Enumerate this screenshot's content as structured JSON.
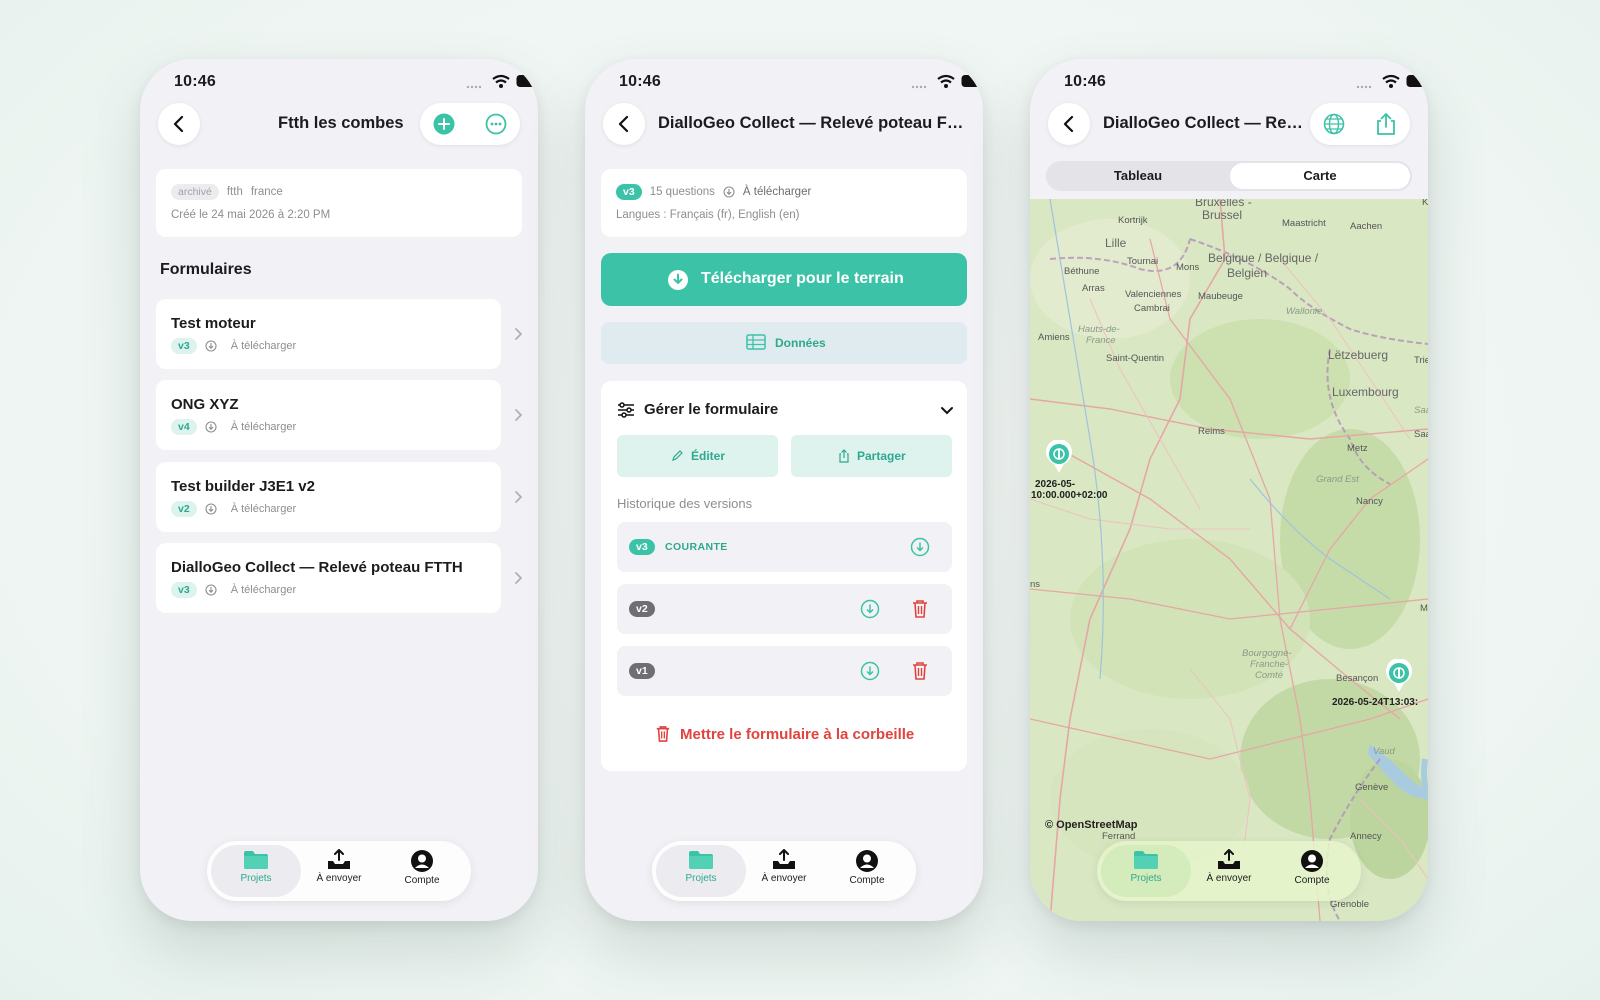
{
  "status_time": "10:46",
  "tabbar": {
    "projects": "Projets",
    "to_send": "À envoyer",
    "account": "Compte"
  },
  "screen1": {
    "title": "Ftth les combes",
    "project_card": {
      "status_chip": "archivé",
      "tags": [
        "ftth",
        "france"
      ],
      "created": "Créé le 24 mai 2026 à 2:20 PM"
    },
    "section_title": "Formulaires",
    "forms": [
      {
        "name": "Test moteur",
        "version": "v3",
        "status": "À télécharger"
      },
      {
        "name": "ONG XYZ",
        "version": "v4",
        "status": "À télécharger"
      },
      {
        "name": "Test builder J3E1 v2",
        "version": "v2",
        "status": "À télécharger"
      },
      {
        "name": "DialloGeo Collect — Relevé poteau FTTH",
        "version": "v3",
        "status": "À télécharger"
      }
    ]
  },
  "screen2": {
    "title": "DialloGeo Collect — Relevé poteau FT...",
    "info": {
      "version": "v3",
      "questions": "15 questions",
      "status": "À télécharger",
      "languages": "Langues : Français (fr), English (en)"
    },
    "download_button": "Télécharger pour le terrain",
    "data_button": "Données",
    "manage": {
      "title": "Gérer le formulaire",
      "edit": "Éditer",
      "share": "Partager"
    },
    "history_label": "Historique des versions",
    "versions": [
      {
        "version": "v3",
        "tag": "COURANTE"
      },
      {
        "version": "v2",
        "tag": ""
      },
      {
        "version": "v1",
        "tag": ""
      }
    ],
    "trash_button": "Mettre le formulaire à la corbeille"
  },
  "screen3": {
    "title": "DialloGeo Collect — Rel...",
    "segments": {
      "table": "Tableau",
      "map": "Carte"
    },
    "selected_segment": "Carte",
    "map_labels": {
      "bruxelles": "Bruxelles -",
      "brussel": "Brussel",
      "kortrijk": "Kortrijk",
      "maastricht": "Maastricht",
      "aachen": "Aachen",
      "lille": "Lille",
      "tournai": "Tournai",
      "belgique": "Belgique / Belgique /",
      "belgien": "Belgien",
      "bethune": "Béthune",
      "mons": "Mons",
      "arras": "Arras",
      "valenciennes": "Valenciennes",
      "maubeuge": "Maubeuge",
      "cambrai": "Cambrai",
      "wallonie": "Wallonie",
      "hauts1": "Hauts-de-",
      "hauts2": "France",
      "amiens": "Amiens",
      "saint_quentin": "Saint-Quentin",
      "letzebuerg": "Lëtzebuerg",
      "trier": "Trie",
      "luxembourg": "Luxembourg",
      "saar": "Saar",
      "sag": "Saa",
      "reims": "Reims",
      "metz": "Metz",
      "grand_est": "Grand Est",
      "nancy": "Nancy",
      "ns": "ns",
      "m": "M",
      "bourgogne1": "Bourgogne-",
      "bourgogne2": "Franche-",
      "bourgogne3": "Comté",
      "besancon": "Besançon",
      "vaud": "Vaud",
      "geneve": "Genève",
      "annecy": "Annecy",
      "ferrand": "Ferrand",
      "grenoble": "Grenoble",
      "k": "K"
    },
    "pins": [
      {
        "label_line1": "2026-05-",
        "label_line2": "10:00.000+02:00"
      },
      {
        "label_line1": "2026-05-24T13:03:"
      }
    ],
    "attribution": "© OpenStreetMap"
  }
}
